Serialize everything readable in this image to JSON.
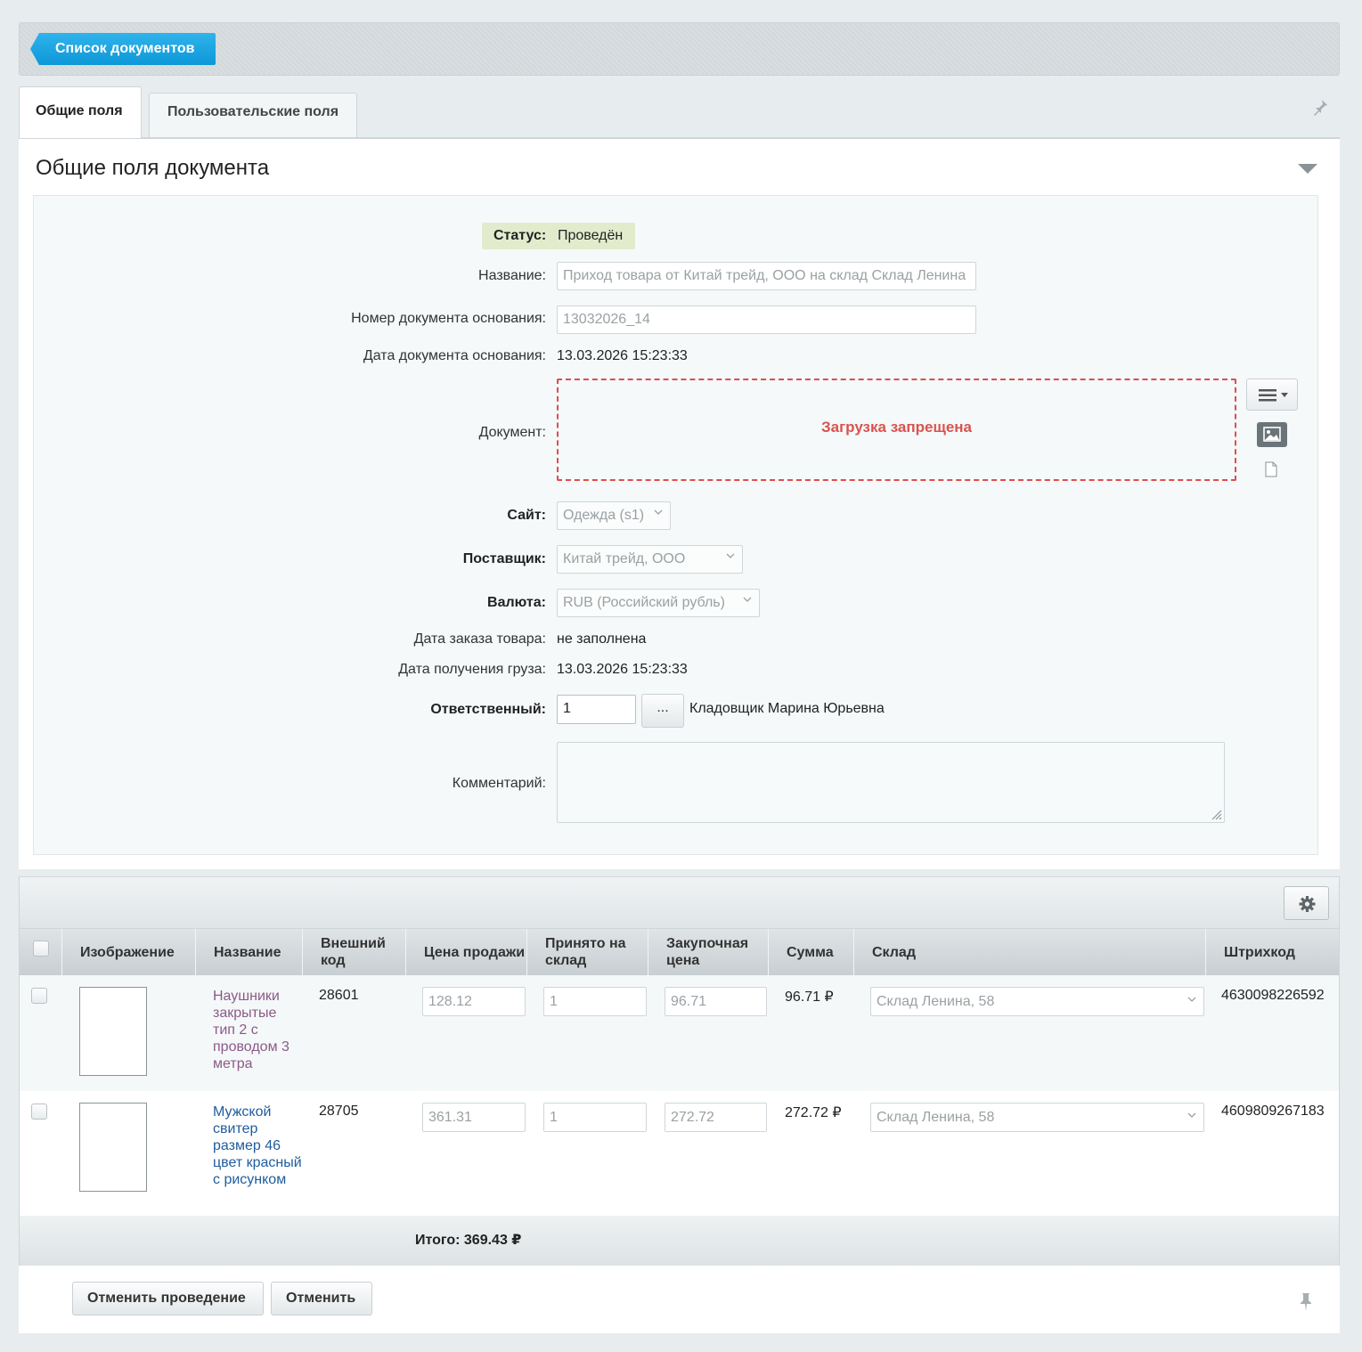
{
  "header": {
    "back_label": "Список документов"
  },
  "tabs": [
    {
      "label": "Общие поля",
      "active": true
    },
    {
      "label": "Пользовательские поля",
      "active": false
    }
  ],
  "section": {
    "title": "Общие поля документа"
  },
  "form": {
    "status_label": "Статус:",
    "status_value": "Проведён",
    "name_label": "Название:",
    "name_value": "Приход товара от Китай трейд, ООО на склад Склад Ленина",
    "doc_number_label": "Номер документа основания:",
    "doc_number_value": "13032026_14",
    "doc_date_label": "Дата документа основания:",
    "doc_date_value": "13.03.2026 15:23:33",
    "document_label": "Документ:",
    "upload_disabled": "Загрузка запрещена",
    "site_label": "Сайт:",
    "site_value": "Одежда (s1)",
    "supplier_label": "Поставщик:",
    "supplier_value": "Китай трейд, ООО",
    "currency_label": "Валюта:",
    "currency_value": "RUB (Российский рубль)",
    "order_date_label": "Дата заказа товара:",
    "order_date_value": "не заполнена",
    "receive_date_label": "Дата получения груза:",
    "receive_date_value": "13.03.2026 15:23:33",
    "responsible_label": "Ответственный:",
    "responsible_id": "1",
    "responsible_btn": "...",
    "responsible_name": "Кладовщик Марина Юрьевна",
    "comment_label": "Комментарий:"
  },
  "products": {
    "columns": [
      "Изображение",
      "Название",
      "Внешний код",
      "Цена продажи",
      "Принято на склад",
      "Закупочная цена",
      "Сумма",
      "Склад",
      "Штрихкод"
    ],
    "rows": [
      {
        "name": "Наушники закрытые тип 2 с проводом 3 метра",
        "external_code": "28601",
        "sale_price": "128.12",
        "accepted": "1",
        "purchase_price": "96.71",
        "sum": "96.71 ₽",
        "warehouse": "Склад Ленина, 58",
        "barcode": "4630098226592"
      },
      {
        "name": "Мужской свитер размер 46 цвет красный с рисунком",
        "external_code": "28705",
        "sale_price": "361.31",
        "accepted": "1",
        "purchase_price": "272.72",
        "sum": "272.72 ₽",
        "warehouse": "Склад Ленина, 58",
        "barcode": "4609809267183"
      }
    ],
    "total": "Итого: 369.43 ₽"
  },
  "actions": {
    "cancel_posting": "Отменить проведение",
    "cancel": "Отменить"
  },
  "colors": {
    "accent": "#1aa5e3",
    "status_bg": "#e2eccd",
    "error": "#d9534f"
  }
}
